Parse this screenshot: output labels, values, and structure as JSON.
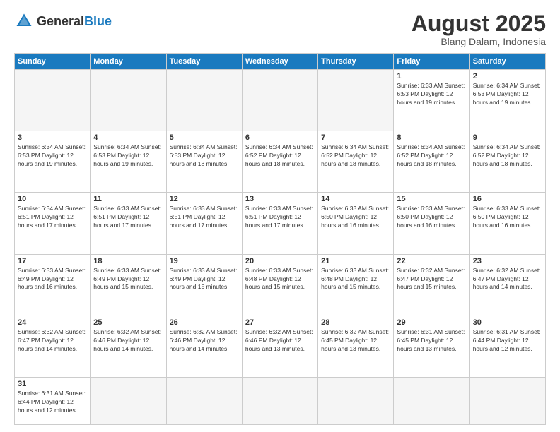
{
  "logo": {
    "text_general": "General",
    "text_blue": "Blue"
  },
  "header": {
    "month_title": "August 2025",
    "subtitle": "Blang Dalam, Indonesia"
  },
  "weekdays": [
    "Sunday",
    "Monday",
    "Tuesday",
    "Wednesday",
    "Thursday",
    "Friday",
    "Saturday"
  ],
  "weeks": [
    [
      {
        "day": "",
        "info": ""
      },
      {
        "day": "",
        "info": ""
      },
      {
        "day": "",
        "info": ""
      },
      {
        "day": "",
        "info": ""
      },
      {
        "day": "",
        "info": ""
      },
      {
        "day": "1",
        "info": "Sunrise: 6:33 AM\nSunset: 6:53 PM\nDaylight: 12 hours and 19 minutes."
      },
      {
        "day": "2",
        "info": "Sunrise: 6:34 AM\nSunset: 6:53 PM\nDaylight: 12 hours and 19 minutes."
      }
    ],
    [
      {
        "day": "3",
        "info": "Sunrise: 6:34 AM\nSunset: 6:53 PM\nDaylight: 12 hours and 19 minutes."
      },
      {
        "day": "4",
        "info": "Sunrise: 6:34 AM\nSunset: 6:53 PM\nDaylight: 12 hours and 19 minutes."
      },
      {
        "day": "5",
        "info": "Sunrise: 6:34 AM\nSunset: 6:53 PM\nDaylight: 12 hours and 18 minutes."
      },
      {
        "day": "6",
        "info": "Sunrise: 6:34 AM\nSunset: 6:52 PM\nDaylight: 12 hours and 18 minutes."
      },
      {
        "day": "7",
        "info": "Sunrise: 6:34 AM\nSunset: 6:52 PM\nDaylight: 12 hours and 18 minutes."
      },
      {
        "day": "8",
        "info": "Sunrise: 6:34 AM\nSunset: 6:52 PM\nDaylight: 12 hours and 18 minutes."
      },
      {
        "day": "9",
        "info": "Sunrise: 6:34 AM\nSunset: 6:52 PM\nDaylight: 12 hours and 18 minutes."
      }
    ],
    [
      {
        "day": "10",
        "info": "Sunrise: 6:34 AM\nSunset: 6:51 PM\nDaylight: 12 hours and 17 minutes."
      },
      {
        "day": "11",
        "info": "Sunrise: 6:33 AM\nSunset: 6:51 PM\nDaylight: 12 hours and 17 minutes."
      },
      {
        "day": "12",
        "info": "Sunrise: 6:33 AM\nSunset: 6:51 PM\nDaylight: 12 hours and 17 minutes."
      },
      {
        "day": "13",
        "info": "Sunrise: 6:33 AM\nSunset: 6:51 PM\nDaylight: 12 hours and 17 minutes."
      },
      {
        "day": "14",
        "info": "Sunrise: 6:33 AM\nSunset: 6:50 PM\nDaylight: 12 hours and 16 minutes."
      },
      {
        "day": "15",
        "info": "Sunrise: 6:33 AM\nSunset: 6:50 PM\nDaylight: 12 hours and 16 minutes."
      },
      {
        "day": "16",
        "info": "Sunrise: 6:33 AM\nSunset: 6:50 PM\nDaylight: 12 hours and 16 minutes."
      }
    ],
    [
      {
        "day": "17",
        "info": "Sunrise: 6:33 AM\nSunset: 6:49 PM\nDaylight: 12 hours and 16 minutes."
      },
      {
        "day": "18",
        "info": "Sunrise: 6:33 AM\nSunset: 6:49 PM\nDaylight: 12 hours and 15 minutes."
      },
      {
        "day": "19",
        "info": "Sunrise: 6:33 AM\nSunset: 6:49 PM\nDaylight: 12 hours and 15 minutes."
      },
      {
        "day": "20",
        "info": "Sunrise: 6:33 AM\nSunset: 6:48 PM\nDaylight: 12 hours and 15 minutes."
      },
      {
        "day": "21",
        "info": "Sunrise: 6:33 AM\nSunset: 6:48 PM\nDaylight: 12 hours and 15 minutes."
      },
      {
        "day": "22",
        "info": "Sunrise: 6:32 AM\nSunset: 6:47 PM\nDaylight: 12 hours and 15 minutes."
      },
      {
        "day": "23",
        "info": "Sunrise: 6:32 AM\nSunset: 6:47 PM\nDaylight: 12 hours and 14 minutes."
      }
    ],
    [
      {
        "day": "24",
        "info": "Sunrise: 6:32 AM\nSunset: 6:47 PM\nDaylight: 12 hours and 14 minutes."
      },
      {
        "day": "25",
        "info": "Sunrise: 6:32 AM\nSunset: 6:46 PM\nDaylight: 12 hours and 14 minutes."
      },
      {
        "day": "26",
        "info": "Sunrise: 6:32 AM\nSunset: 6:46 PM\nDaylight: 12 hours and 14 minutes."
      },
      {
        "day": "27",
        "info": "Sunrise: 6:32 AM\nSunset: 6:46 PM\nDaylight: 12 hours and 13 minutes."
      },
      {
        "day": "28",
        "info": "Sunrise: 6:32 AM\nSunset: 6:45 PM\nDaylight: 12 hours and 13 minutes."
      },
      {
        "day": "29",
        "info": "Sunrise: 6:31 AM\nSunset: 6:45 PM\nDaylight: 12 hours and 13 minutes."
      },
      {
        "day": "30",
        "info": "Sunrise: 6:31 AM\nSunset: 6:44 PM\nDaylight: 12 hours and 12 minutes."
      }
    ],
    [
      {
        "day": "31",
        "info": "Sunrise: 6:31 AM\nSunset: 6:44 PM\nDaylight: 12 hours and 12 minutes."
      },
      {
        "day": "",
        "info": ""
      },
      {
        "day": "",
        "info": ""
      },
      {
        "day": "",
        "info": ""
      },
      {
        "day": "",
        "info": ""
      },
      {
        "day": "",
        "info": ""
      },
      {
        "day": "",
        "info": ""
      }
    ]
  ]
}
